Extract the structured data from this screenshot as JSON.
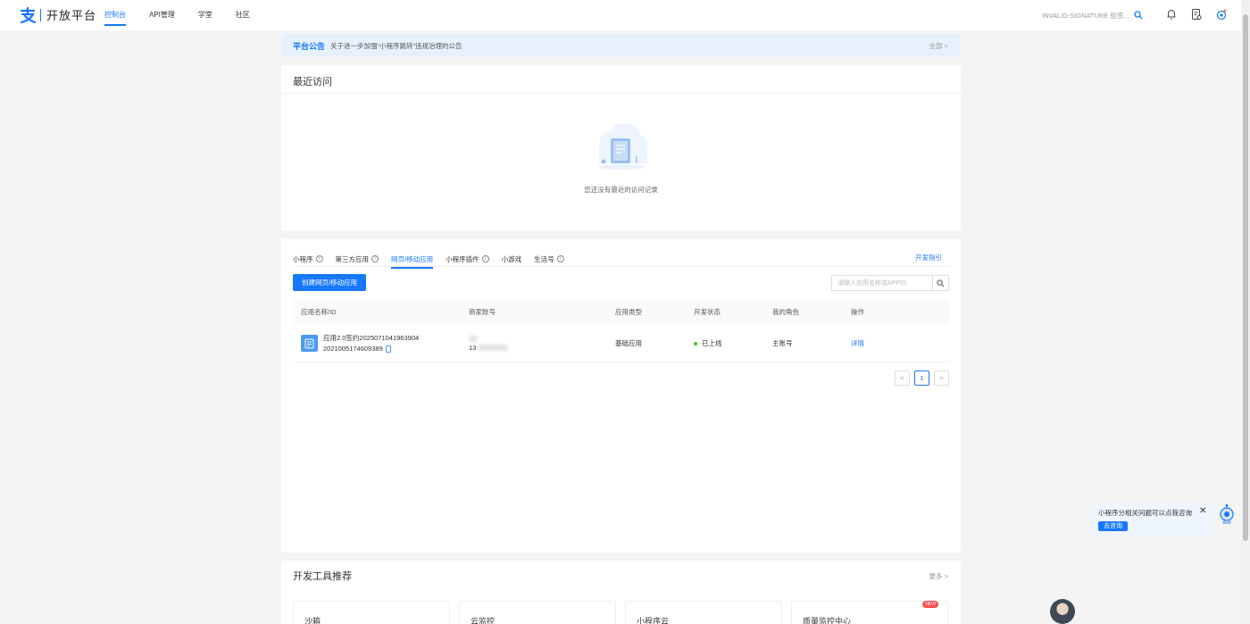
{
  "brand": {
    "logo_char": "支",
    "name": "开放平台"
  },
  "nav": [
    {
      "label": "控制台",
      "active": true
    },
    {
      "label": "API管理",
      "active": false
    },
    {
      "label": "学堂",
      "active": false
    },
    {
      "label": "社区",
      "active": false
    }
  ],
  "header": {
    "search_placeholder": "INVALID-SIGNATURE 验签...",
    "icons": [
      "search-icon",
      "bell-icon",
      "document-check-icon",
      "robot-avatar-icon"
    ]
  },
  "notice": {
    "tag": "平台公告",
    "text": "关于进一步加强“小程序跳转”违规治理的公告",
    "all_link": "全部 >"
  },
  "recent": {
    "title": "最近访问",
    "empty_text": "您还没有最近的访问记录"
  },
  "apps": {
    "tabs": [
      {
        "label": "小程序",
        "info": true,
        "active": false
      },
      {
        "label": "第三方应用",
        "info": true,
        "active": false
      },
      {
        "label": "网页/移动应用",
        "info": false,
        "active": true
      },
      {
        "label": "小程序插件",
        "info": true,
        "active": false
      },
      {
        "label": "小游戏",
        "info": false,
        "active": false
      },
      {
        "label": "生活号",
        "info": true,
        "active": false
      }
    ],
    "dev_guide": "开发指引",
    "create_button": "创建网页/移动应用",
    "search_placeholder": "请输入应用名称或APPID",
    "columns": [
      "应用名称/ID",
      "商家账号",
      "应用类型",
      "开发状态",
      "我的角色",
      "操作"
    ],
    "rows": [
      {
        "name": "应用2.0签约2025071041963904",
        "id": "2021005174609389",
        "merchant_account_visible": "13",
        "type": "基础应用",
        "status": "已上线",
        "role": "主账号",
        "action": "详情"
      }
    ],
    "pagination": {
      "current": "1",
      "prev": "<",
      "next": ">"
    }
  },
  "tools": {
    "title": "开发工具推荐",
    "more": "更多 >",
    "cards": [
      {
        "label": "沙箱",
        "badge": ""
      },
      {
        "label": "云监控",
        "badge": ""
      },
      {
        "label": "小程序云",
        "badge": ""
      },
      {
        "label": "质量监控中心",
        "badge": "NEW"
      }
    ]
  },
  "helper": {
    "text": "小程序分相关问题可以点我咨询",
    "button": "去咨询",
    "close": "✕"
  },
  "colors": {
    "primary": "#1677ff",
    "notice_bg": "#e7f1fd",
    "success": "#52c41a",
    "badge_red": "#ff4d4f"
  }
}
